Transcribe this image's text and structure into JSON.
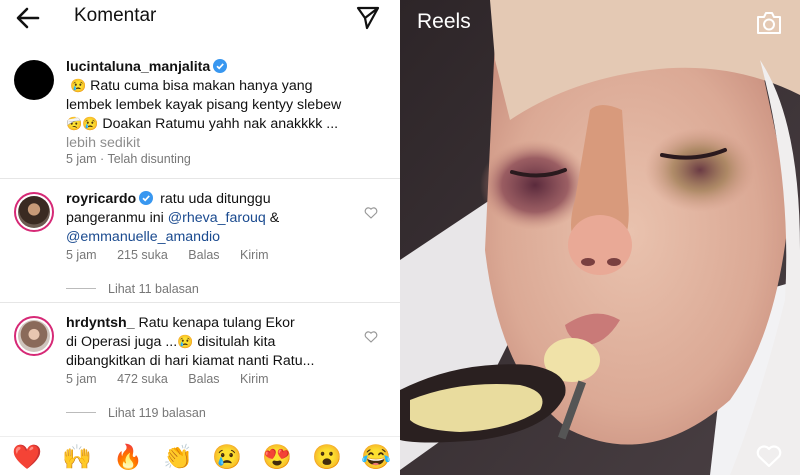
{
  "header": {
    "title": "Komentar",
    "back_icon": "arrow-left-icon",
    "send_icon": "paper-plane-icon"
  },
  "caption": {
    "username": "lucintaluna_manjalita",
    "line1": "Ratu cuma bisa makan hanya yang",
    "line2": "lembek lembek kayak pisang kentyy slebew",
    "line3": "Doakan Ratumu yahh nak anakkkk ...",
    "more": "lebih sedikit",
    "meta": "5 jam · Telah disunting",
    "emoji_1": "😢",
    "emoji_2": "🤕😢"
  },
  "comments": [
    {
      "username": "royricardo",
      "text_a": "ratu uda ditunggu",
      "text_b": "pangeranmu ini",
      "mention_1": "@rheva_farouq",
      "amp": "&",
      "mention_2": "@emmanuelle_amandio",
      "time": "5 jam",
      "likes": "215 suka",
      "reply": "Balas",
      "send": "Kirim",
      "replies": "Lihat 11 balasan"
    },
    {
      "username": "hrdyntsh_",
      "text_a": "Ratu kenapa tulang Ekor",
      "text_b": "di Operasi juga ...",
      "emoji": "😢",
      "text_c": "disitulah kita",
      "text_d": "dibangkitkan di hari kiamat nanti Ratu...",
      "time": "5 jam",
      "likes": "472 suka",
      "reply": "Balas",
      "send": "Kirim",
      "replies": "Lihat 119 balasan"
    }
  ],
  "emoji_bar": [
    "❤️",
    "🙌",
    "🔥",
    "👏",
    "😢",
    "😍",
    "😮",
    "😂"
  ],
  "reels": {
    "label": "Reels",
    "camera_icon": "camera-icon",
    "like_icon": "heart-outline-icon"
  },
  "colors": {
    "verified": "#3897f0",
    "mention": "#1a4a8f",
    "muted": "#8e8e8e",
    "story_ring": "#d62976"
  }
}
